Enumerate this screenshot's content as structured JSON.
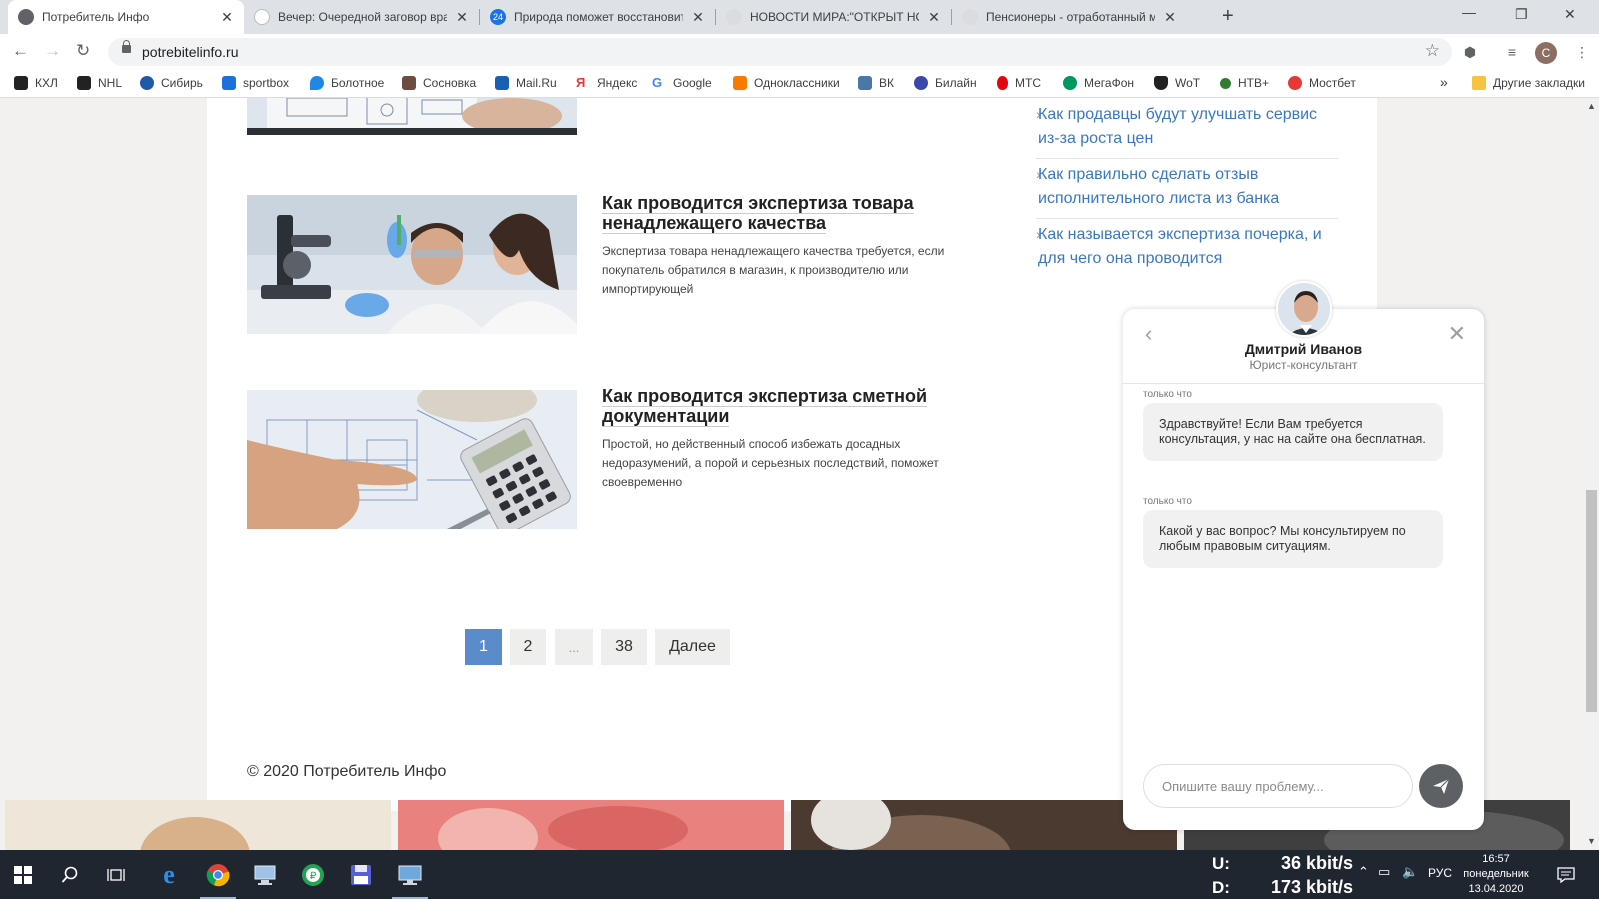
{
  "browser": {
    "tabs": [
      {
        "title": "Потребитель Инфо",
        "active": true,
        "favicon_color": "#5f6368",
        "favicon_text": ""
      },
      {
        "title": "Вечер: Очередной заговор вра",
        "active": false,
        "favicon_color": "#ffffff",
        "favicon_text": ""
      },
      {
        "title": "Природа поможет восстановит",
        "active": false,
        "favicon_color": "#1a73e8",
        "favicon_text": "24"
      },
      {
        "title": "НОВОСТИ МИРА:\"ОТКРЫТ НОВ",
        "active": false,
        "favicon_color": "#dadce0",
        "favicon_text": ""
      },
      {
        "title": "Пенсионеры - отработанный м",
        "active": false,
        "favicon_color": "#dadce0",
        "favicon_text": ""
      }
    ],
    "url": "potrebitelinfo.ru",
    "profile_initial": "C",
    "bookmarks": [
      {
        "label": "КХЛ",
        "color": "#222222"
      },
      {
        "label": "NHL",
        "color": "#222222"
      },
      {
        "label": "Сибирь",
        "color": "#1e5aa8"
      },
      {
        "label": "sportbox",
        "color": "#1e6fd9"
      },
      {
        "label": "Болотное",
        "color": "#1e88e5"
      },
      {
        "label": "Сосновка",
        "color": "#6d4c41"
      },
      {
        "label": "Mail.Ru",
        "color": "#1a5fb4"
      },
      {
        "label": "Яндекс",
        "color": "#e53935"
      },
      {
        "label": "Google",
        "color": "#4285f4"
      },
      {
        "label": "Одноклассники",
        "color": "#f57c00"
      },
      {
        "label": "ВК",
        "color": "#4a76a8"
      },
      {
        "label": "Билайн",
        "color": "#3949ab"
      },
      {
        "label": "МТС",
        "color": "#e30611"
      },
      {
        "label": "МегаФон",
        "color": "#00985f"
      },
      {
        "label": "WoT",
        "color": "#222222"
      },
      {
        "label": "НТВ+",
        "color": "#2e7d32"
      },
      {
        "label": "Мостбет",
        "color": "#e53935"
      }
    ],
    "bookmarks_overflow": "»",
    "other_bookmarks": "Другие закладки"
  },
  "articles": [
    {
      "title": "Как проводится экспертиза товара ненадлежащего качества",
      "excerpt": "Экспертиза товара ненадлежащего качества требуется, если покупатель обратился в магазин, к производителю или импортирующей"
    },
    {
      "title": "Как проводится экспертиза сметной документации",
      "excerpt": "Простой, но действенный способ избежать досадных недоразумений, а порой и серьезных последствий, поможет своевременно"
    }
  ],
  "pagination": {
    "pages": [
      "1",
      "2",
      "...",
      "38"
    ],
    "current": "1",
    "next_label": "Далее"
  },
  "footer": {
    "copyright": "© 2020 Потребитель Инфо"
  },
  "sidebar": {
    "links": [
      "Как продавцы будут улучшать сервис из-за роста цен",
      "Как правильно сделать отзыв исполнительного листа из банка",
      "Как называется экспертиза почерка, и для чего она проводится"
    ]
  },
  "chat": {
    "agent_name": "Дмитрий Иванов",
    "agent_role": "Юрист-консультант",
    "messages": [
      {
        "time": "только что",
        "text": "Здравствуйте! Если Вам требуется консультация, у нас на сайте она бесплатная."
      },
      {
        "time": "только что",
        "text": "Какой у вас вопрос? Мы консультируем по любым правовым ситуациям."
      }
    ],
    "input_placeholder": "Опишите вашу проблему..."
  },
  "taskbar": {
    "net_up_label": "U:",
    "net_up_value": "36 kbit/s",
    "net_down_label": "D:",
    "net_down_value": "173 kbit/s",
    "language": "РУС",
    "time": "16:57",
    "weekday": "понедельник",
    "date": "13.04.2020"
  }
}
